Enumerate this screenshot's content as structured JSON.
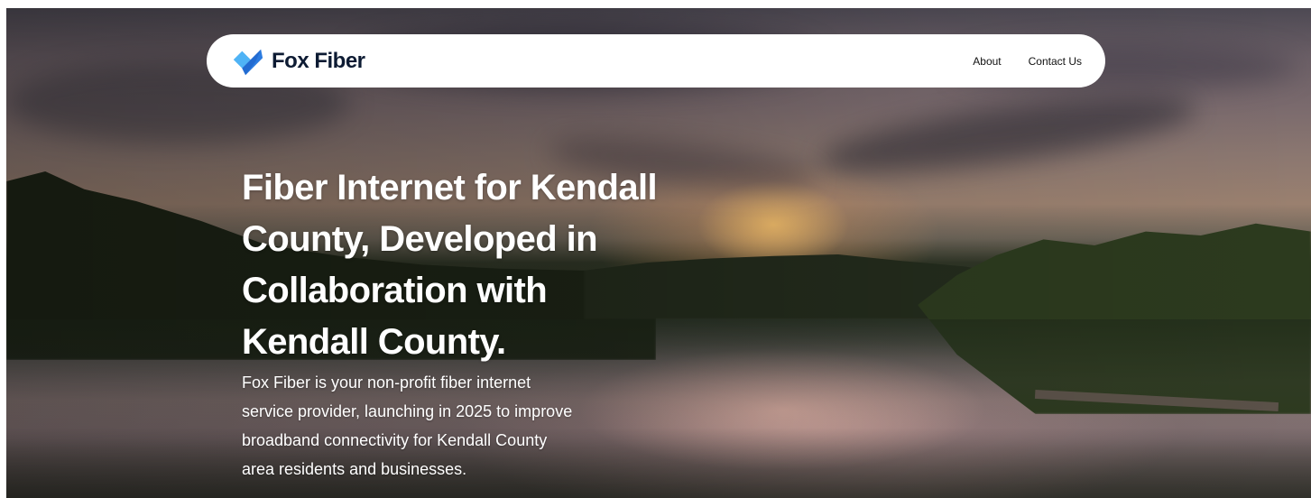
{
  "brand": {
    "name": "Fox Fiber",
    "logo_icon": "fox-fiber-logo-icon",
    "logo_colors": [
      "#2b7be0",
      "#4fb3f5"
    ]
  },
  "nav": {
    "links": [
      {
        "label": "About"
      },
      {
        "label": "Contact Us"
      }
    ]
  },
  "hero": {
    "background": "sunset-lake-photo",
    "headline_lines": [
      "Fiber Internet for Kendall",
      "County, Developed in",
      "Collaboration with",
      "Kendall County."
    ],
    "subtext_lines": [
      "Fox Fiber is your non-profit fiber internet",
      "service provider, launching in 2025 to improve",
      "broadband connectivity for Kendall County",
      "area residents and businesses."
    ]
  }
}
